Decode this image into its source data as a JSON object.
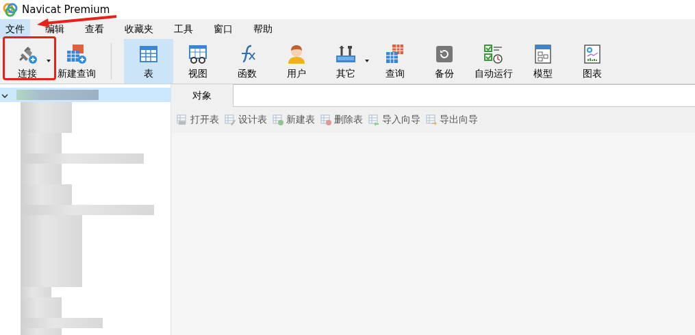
{
  "window": {
    "title": "Navicat Premium"
  },
  "menu": [
    {
      "label": "文件",
      "selected": true
    },
    {
      "label": "编辑",
      "selected": false
    },
    {
      "label": "查看",
      "selected": false
    },
    {
      "label": "收藏夹",
      "selected": false
    },
    {
      "label": "工具",
      "selected": false
    },
    {
      "label": "窗口",
      "selected": false
    },
    {
      "label": "帮助",
      "selected": false
    }
  ],
  "toolbar": [
    {
      "label": "连接",
      "selected": false,
      "dropdown": true,
      "separator_before": false
    },
    {
      "label": "新建查询",
      "selected": false,
      "dropdown": false,
      "separator_before": false
    },
    {
      "label": "表",
      "selected": true,
      "dropdown": false,
      "separator_before": true
    },
    {
      "label": "视图",
      "selected": false,
      "dropdown": false,
      "separator_before": false
    },
    {
      "label": "函数",
      "selected": false,
      "dropdown": false,
      "separator_before": false
    },
    {
      "label": "用户",
      "selected": false,
      "dropdown": false,
      "separator_before": false
    },
    {
      "label": "其它",
      "selected": false,
      "dropdown": true,
      "separator_before": false
    },
    {
      "label": "查询",
      "selected": false,
      "dropdown": false,
      "separator_before": false
    },
    {
      "label": "备份",
      "selected": false,
      "dropdown": false,
      "separator_before": false
    },
    {
      "label": "自动运行",
      "selected": false,
      "dropdown": false,
      "separator_before": false
    },
    {
      "label": "模型",
      "selected": false,
      "dropdown": false,
      "separator_before": false
    },
    {
      "label": "图表",
      "selected": false,
      "dropdown": false,
      "separator_before": false
    }
  ],
  "sidebar": {
    "items": [
      {
        "kind": "redacted",
        "selected": true,
        "expanded": true,
        "children": [
          {
            "kind": "redacted"
          },
          {
            "kind": "redacted"
          },
          {
            "kind": "redacted"
          },
          {
            "kind": "redacted"
          },
          {
            "kind": "redacted"
          },
          {
            "kind": "redacted"
          },
          {
            "kind": "redacted"
          },
          {
            "kind": "redacted"
          },
          {
            "kind": "redacted"
          },
          {
            "kind": "redacted"
          },
          {
            "kind": "redacted"
          },
          {
            "kind": "redacted"
          },
          {
            "kind": "redacted"
          },
          {
            "kind": "redacted"
          },
          {
            "kind": "redacted"
          },
          {
            "kind": "redacted"
          },
          {
            "kind": "redacted"
          },
          {
            "kind": "redacted"
          },
          {
            "kind": "redacted"
          },
          {
            "kind": "redacted"
          },
          {
            "kind": "redacted"
          },
          {
            "kind": "redacted"
          },
          {
            "kind": "redacted"
          }
        ]
      }
    ]
  },
  "tabs": [
    {
      "label": "对象",
      "selected": true
    }
  ],
  "object_toolbar": [
    {
      "label": "打开表",
      "disabled": true
    },
    {
      "label": "设计表",
      "disabled": true
    },
    {
      "label": "新建表",
      "disabled": true
    },
    {
      "label": "删除表",
      "disabled": true
    },
    {
      "label": "导入向导",
      "disabled": true
    },
    {
      "label": "导出向导",
      "disabled": true
    }
  ]
}
